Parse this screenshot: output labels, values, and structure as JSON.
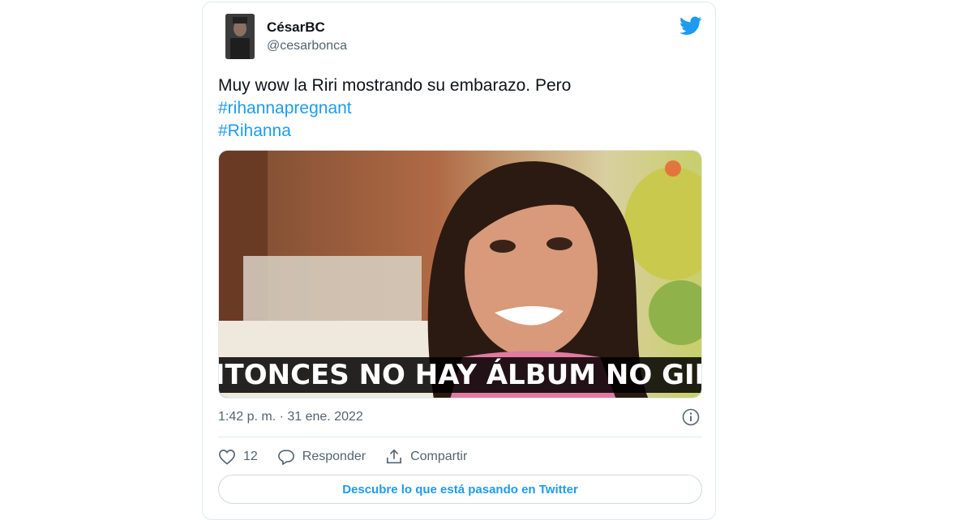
{
  "user": {
    "display_name": "CésarBC",
    "handle": "@cesarbonca",
    "avatar_icon": "user-avatar"
  },
  "tweet": {
    "text": "Muy wow la Riri mostrando su embarazo. Pero",
    "hashtags": [
      "#rihannapregnant",
      "#Rihanna"
    ],
    "media_caption": "ENTONCES NO HAY ÁLBUM NO GIRA",
    "timestamp": "1:42 p. m. · 31 ene. 2022"
  },
  "actions": {
    "like_count": "12",
    "reply_label": "Responder",
    "share_label": "Compartir"
  },
  "cta": {
    "label": "Descubre lo que está pasando en Twitter"
  },
  "colors": {
    "brand": "#1d9bf0",
    "text": "#0f1419",
    "secondary": "#536471"
  },
  "icons": [
    "twitter-bird-icon",
    "info-icon",
    "heart-icon",
    "reply-icon",
    "share-icon"
  ]
}
